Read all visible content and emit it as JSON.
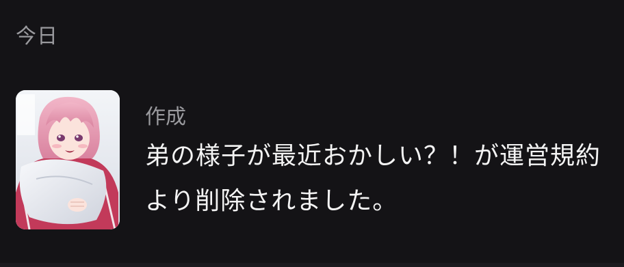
{
  "section": {
    "header": "今日"
  },
  "notification": {
    "category": "作成",
    "message_line_1": "弟の様子が最近おかしい？！が運営規約",
    "message_line_2": "より削除されました。",
    "thumbnail_icon": "anime-character-thumbnail"
  },
  "colors": {
    "background": "#141316",
    "muted_text": "#9a9a9e",
    "primary_text": "#f4f4f4"
  }
}
